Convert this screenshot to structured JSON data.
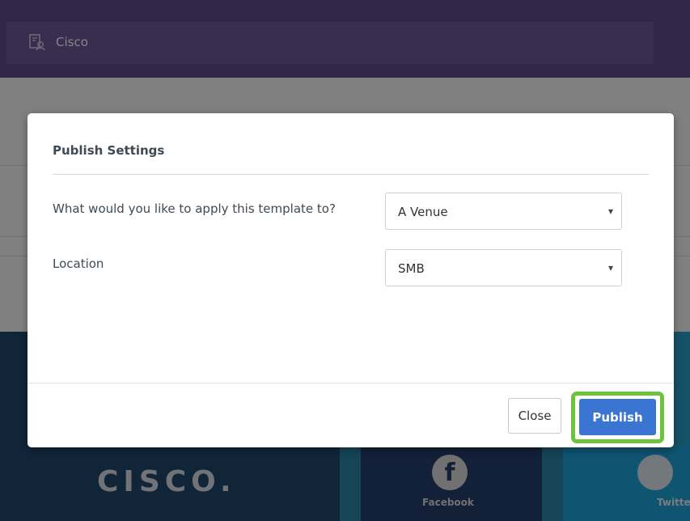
{
  "header": {
    "tenant_name": "Cisco",
    "tenant_icon": "directory-search-icon"
  },
  "preview": {
    "brand_text": "CISCO.",
    "facebook_label": "Facebook",
    "twitter_label": "Twitter",
    "facebook_icon_glyph": "f"
  },
  "modal": {
    "title": "Publish Settings",
    "apply_label": "What would you like to apply this template to?",
    "apply_value": "A Venue",
    "location_label": "Location",
    "location_value": "SMB",
    "caret": "▾",
    "close_label": "Close",
    "publish_label": "Publish",
    "highlight_color": "#6fc23c",
    "primary_color": "#3a75d1"
  }
}
